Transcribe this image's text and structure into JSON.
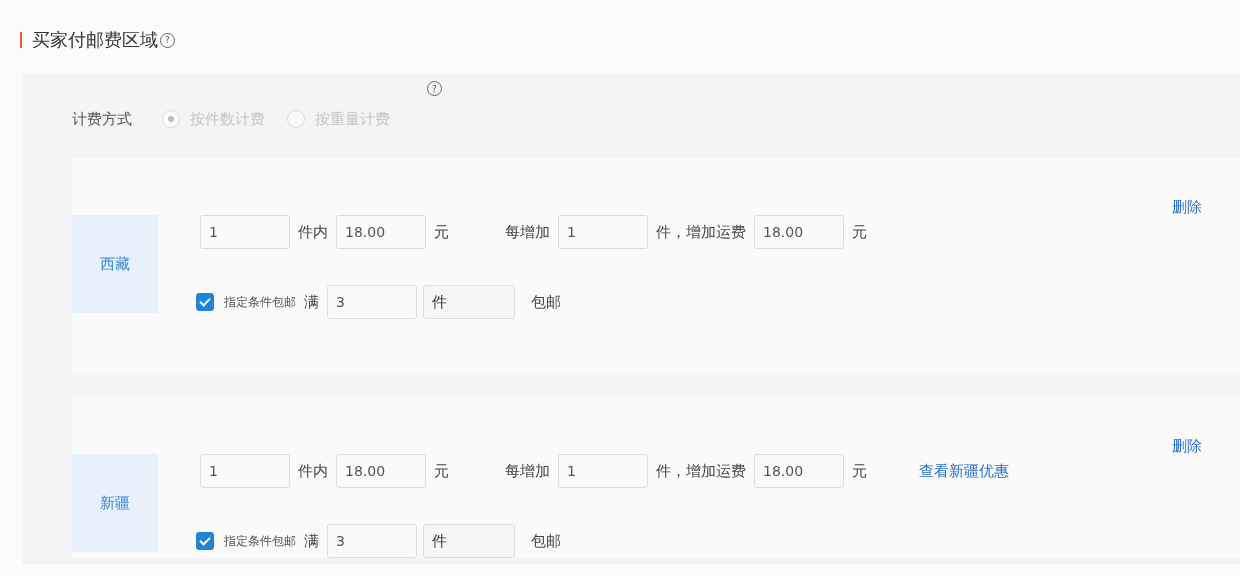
{
  "section": {
    "title": "买家付邮费区域",
    "help": "?"
  },
  "panel_help": "?",
  "billing": {
    "label": "计费方式",
    "options": [
      {
        "label": "按件数计费",
        "selected": true
      },
      {
        "label": "按重量计费",
        "selected": false
      }
    ]
  },
  "regions": [
    {
      "name": "西藏",
      "first_count": "1",
      "first_unit": "件内",
      "first_fee": "18.00",
      "first_currency": "元",
      "add_label": "每增加",
      "add_count": "1",
      "add_unit": "件，增加运费",
      "add_fee": "18.00",
      "add_currency": "元",
      "delete": "删除",
      "free_shipping": {
        "checked": true,
        "label": "指定条件包邮",
        "prefix": "满",
        "count": "3",
        "unit": "件",
        "suffix": "包邮"
      }
    },
    {
      "name": "新疆",
      "first_count": "1",
      "first_unit": "件内",
      "first_fee": "18.00",
      "first_currency": "元",
      "add_label": "每增加",
      "add_count": "1",
      "add_unit": "件，增加运费",
      "add_fee": "18.00",
      "add_currency": "元",
      "delete": "删除",
      "link": "查看新疆优惠",
      "free_shipping": {
        "checked": true,
        "label": "指定条件包邮",
        "prefix": "满",
        "count": "3",
        "unit": "件",
        "suffix": "包邮"
      }
    }
  ]
}
